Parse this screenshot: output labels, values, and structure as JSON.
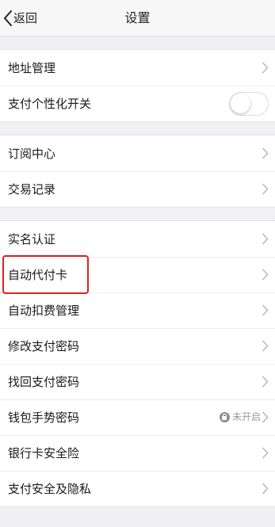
{
  "header": {
    "back_label": "返回",
    "title": "设置"
  },
  "groups": [
    [
      {
        "label": "地址管理",
        "type": "chevron"
      },
      {
        "label": "支付个性化开关",
        "type": "toggle",
        "toggle_on": false
      }
    ],
    [
      {
        "label": "订阅中心",
        "type": "chevron"
      },
      {
        "label": "交易记录",
        "type": "chevron"
      }
    ],
    [
      {
        "label": "实名认证",
        "type": "chevron"
      },
      {
        "label": "自动代付卡",
        "type": "chevron",
        "highlighted": true
      },
      {
        "label": "自动扣费管理",
        "type": "chevron"
      },
      {
        "label": "修改支付密码",
        "type": "chevron"
      },
      {
        "label": "找回支付密码",
        "type": "chevron"
      },
      {
        "label": "钱包手势密码",
        "type": "status",
        "status": "未开启"
      },
      {
        "label": "银行卡安全险",
        "type": "chevron"
      },
      {
        "label": "支付安全及隐私",
        "type": "chevron"
      }
    ]
  ],
  "colors": {
    "highlight": "#e02020",
    "background": "#efeff4"
  }
}
